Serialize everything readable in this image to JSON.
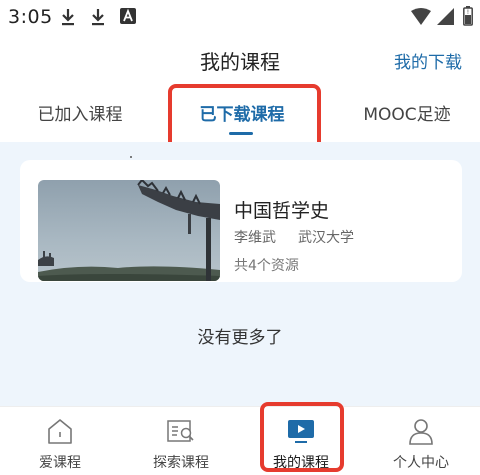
{
  "status_bar": {
    "time": "3:05",
    "left_icons": [
      "download-icon",
      "download-icon",
      "font-a-icon"
    ],
    "right_icons": [
      "wifi-icon",
      "cell-signal-icon",
      "battery-icon"
    ]
  },
  "header": {
    "title": "我的课程",
    "right_link": "我的下载"
  },
  "tabs": [
    {
      "label": "已加入课程",
      "active": false
    },
    {
      "label": "已下载课程",
      "active": true
    },
    {
      "label": "MOOC足迹",
      "active": false
    }
  ],
  "course_card": {
    "title": "中国哲学史",
    "teacher": "李维武",
    "school": "武汉大学",
    "resources": "共4个资源",
    "thumbnail": "pavilion-roof-photo"
  },
  "no_more_text": "没有更多了",
  "bottom_nav": [
    {
      "label": "爱课程",
      "icon": "home-icon",
      "active": false
    },
    {
      "label": "探索课程",
      "icon": "explore-icon",
      "active": false
    },
    {
      "label": "我的课程",
      "icon": "play-screen-icon",
      "active": true
    },
    {
      "label": "个人中心",
      "icon": "person-icon",
      "active": false
    }
  ],
  "colors": {
    "accent": "#1e6ba8",
    "highlight": "#e63b2e",
    "content_bg": "#eef5fc"
  }
}
